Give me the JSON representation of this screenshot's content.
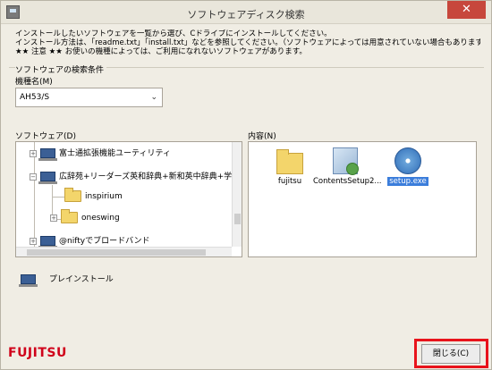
{
  "window": {
    "title": "ソフトウェアディスク検索",
    "close_glyph": "✕"
  },
  "notes": [
    "インストールしたいソフトウェアを一覧から選び、Cドライブにインストールしてください。",
    "インストール方法は、「readme.txt」「install.txt」などを参照してください。（ソフトウェアによっては用意されていない場合もあります）",
    "★★ 注意 ★★ お使いの機種によっては、ご利用になれないソフトウェアがあります。"
  ],
  "search": {
    "group_label": "ソフトウェアの検索条件",
    "model_label": "機種名(M)",
    "model_value": "AH53/S",
    "dropdown_icon": "chevron-down-icon"
  },
  "software": {
    "label": "ソフトウェア(D)",
    "tree": [
      {
        "label": "富士通拡張機能ユーティリティ",
        "icon": "laptop-icon",
        "expander": "+"
      },
      {
        "label": "広辞苑+リーダーズ英和辞典+新和英中辞典+学研",
        "icon": "laptop-icon",
        "expander": "−"
      },
      {
        "label": "inspirium",
        "icon": "folder-icon",
        "expander": ""
      },
      {
        "label": "oneswing",
        "icon": "folder-icon",
        "expander": "+"
      },
      {
        "label": "@niftyでブロードバンド",
        "icon": "laptop-icon",
        "expander": "+"
      }
    ]
  },
  "contents": {
    "label": "内容(N)",
    "files": [
      {
        "label": "fujitsu",
        "icon": "folder-icon"
      },
      {
        "label": "ContentsSetup2...",
        "icon": "setup-icon"
      },
      {
        "label": "setup.exe",
        "icon": "disc-icon",
        "selected": true
      }
    ]
  },
  "preinstall_label": "プレインストール",
  "brand": "FUJITSU",
  "close_button": "閉じる(C)",
  "colors": {
    "selection": "#3b7ddb",
    "brand": "#d0021b",
    "highlight": "#e8131b"
  }
}
